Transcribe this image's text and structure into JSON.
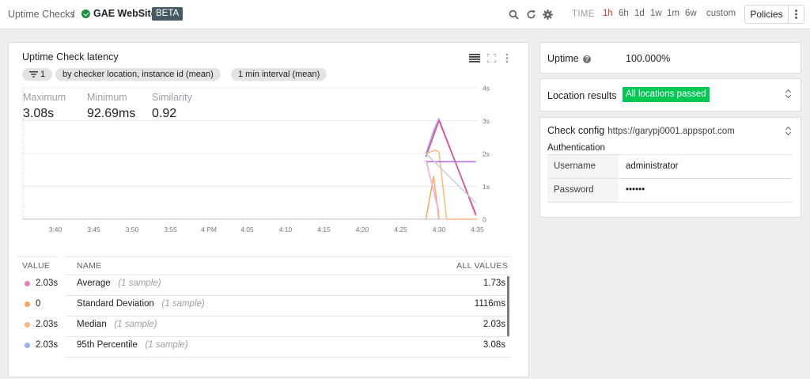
{
  "breadcrumb": {
    "parent": "Uptime Checks",
    "separator": "/",
    "current": "GAE WebSite",
    "badge": "BETA"
  },
  "toolbar": {
    "time_label": "TIME",
    "ranges": [
      {
        "label": "1h",
        "active": true
      },
      {
        "label": "6h",
        "active": false
      },
      {
        "label": "1d",
        "active": false
      },
      {
        "label": "1w",
        "active": false
      },
      {
        "label": "1m",
        "active": false
      },
      {
        "label": "6w",
        "active": false
      },
      {
        "label": "custom",
        "active": false
      }
    ],
    "policies_label": "Policies",
    "icons": [
      "search-icon",
      "refresh-icon",
      "gear-icon",
      "more-vert-icon"
    ]
  },
  "chart_card": {
    "title": "Uptime Check latency",
    "header_icons": [
      "legend-list-icon",
      "fullscreen-icon",
      "more-vert-icon"
    ],
    "chips": [
      "1",
      "by checker location, instance id (mean)",
      "1 min interval (mean)"
    ],
    "chip_icon": "filter-icon",
    "stats": [
      {
        "label": "Maximum",
        "value": "3.08s"
      },
      {
        "label": "Minimum",
        "value": "92.69ms"
      },
      {
        "label": "Similarity",
        "value": "0.92"
      }
    ]
  },
  "chart_data": {
    "type": "line",
    "x_tick_labels": [
      "3:40",
      "3:45",
      "3:50",
      "3:55",
      "4 PM",
      "4:05",
      "4:10",
      "4:15",
      "4:20",
      "4:25",
      "4:30",
      "4:35"
    ],
    "y_tick_labels": [
      "4s",
      "3s",
      "2s",
      "1s",
      "0"
    ],
    "ylim": [
      0,
      4
    ],
    "x_unit": "minutes after 3:40",
    "grid": true,
    "series": [
      {
        "color": "#e67fc2",
        "x": [
          48.3,
          50.0,
          54.8
        ],
        "y": [
          2.0,
          3.05,
          0.1
        ]
      },
      {
        "color": "#d44d8f",
        "x": [
          48.3,
          50.0,
          54.8
        ],
        "y": [
          1.9,
          3.0,
          0.15
        ]
      },
      {
        "color": "#f5b87d",
        "x": [
          48.3,
          49.5,
          50.0,
          51.0,
          54.8
        ],
        "y": [
          2.0,
          2.1,
          2.05,
          0.0,
          0.0
        ]
      },
      {
        "color": "#f7a659",
        "x": [
          48.3,
          49.3,
          50.0
        ],
        "y": [
          0.0,
          1.3,
          0.0
        ]
      },
      {
        "color": "#9cb0ec",
        "x": [
          48.3,
          49.3,
          50.0
        ],
        "y": [
          2.0,
          2.7,
          3.08
        ]
      },
      {
        "color": "#b06ad3",
        "x": [
          48.3,
          54.8
        ],
        "y": [
          1.75,
          1.75
        ]
      },
      {
        "color": "#f3a6d8",
        "x": [
          48.3,
          50.0
        ],
        "y": [
          1.8,
          0.2
        ]
      },
      {
        "color": "#c8cdd3",
        "x": [
          48.3,
          54.8
        ],
        "y": [
          2.0,
          0.5
        ]
      }
    ]
  },
  "table": {
    "headers": {
      "value": "VALUE",
      "name": "NAME",
      "all": "ALL VALUES"
    },
    "rows": [
      {
        "color": "#e67fc2",
        "value": "2.03s",
        "name": "Average",
        "sample": "(1 sample)",
        "all": "1.73s"
      },
      {
        "color": "#f7a659",
        "value": "0",
        "name": "Standard Deviation",
        "sample": "(1 sample)",
        "all": "1116ms"
      },
      {
        "color": "#f5b87d",
        "value": "2.03s",
        "name": "Median",
        "sample": "(1 sample)",
        "all": "2.03s"
      },
      {
        "color": "#9cb0ec",
        "value": "2.03s",
        "name": "95th Percentile",
        "sample": "(1 sample)",
        "all": "3.08s"
      }
    ]
  },
  "uptime_card": {
    "label": "Uptime",
    "help_icon": "help-icon",
    "value": "100.000%"
  },
  "location_card": {
    "label": "Location results",
    "status": "All locations passed",
    "status_color": "#00c853"
  },
  "config_card": {
    "label": "Check config",
    "url": "https://garypj0001.appspot.com",
    "auth_title": "Authentication",
    "rows": [
      {
        "key": "Username",
        "value": "administrator"
      },
      {
        "key": "Password",
        "value": "••••••"
      }
    ]
  }
}
